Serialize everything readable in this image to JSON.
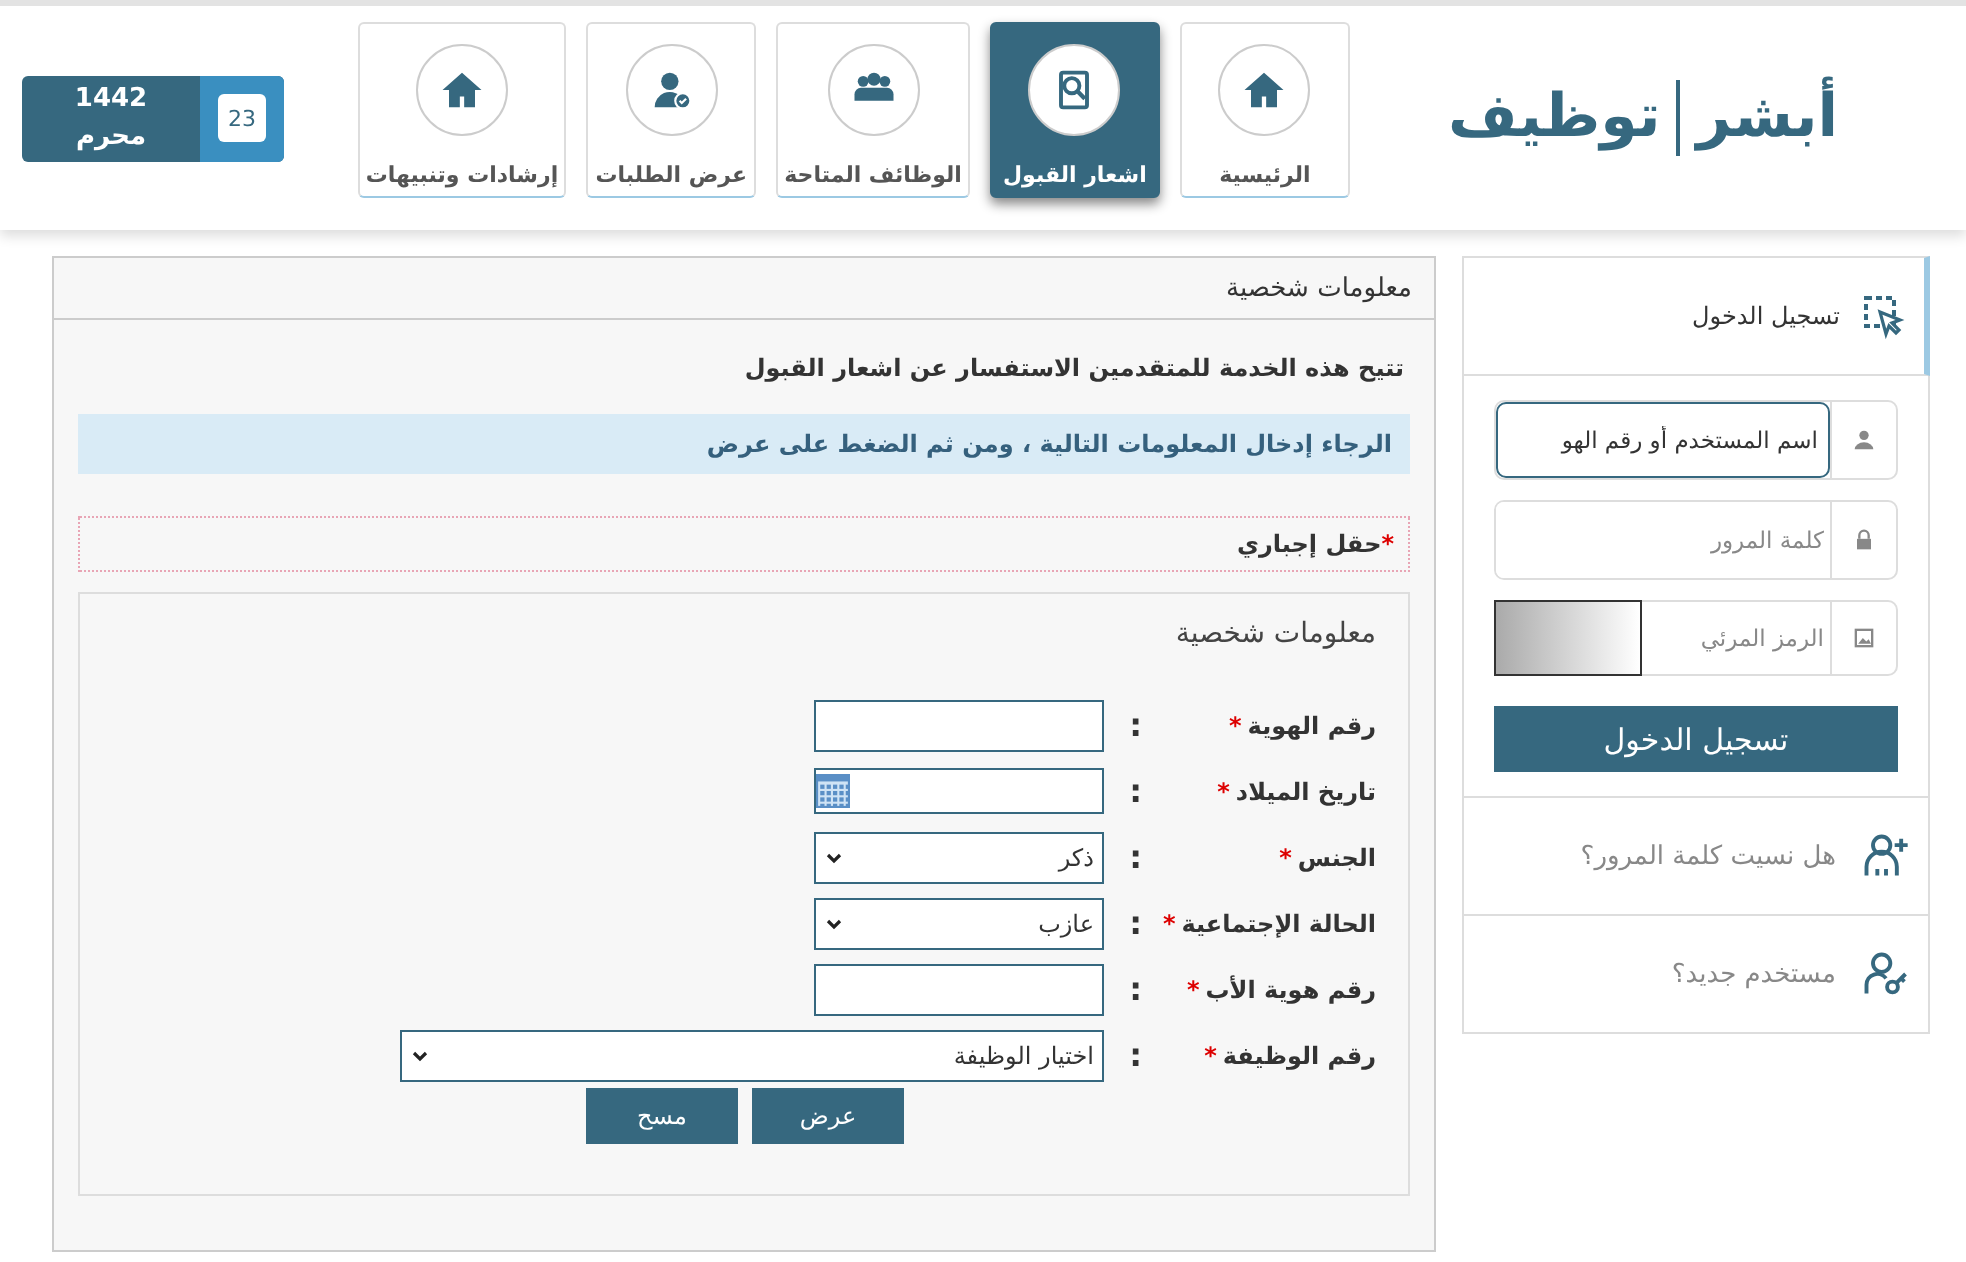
{
  "logo": {
    "primary": "أبشر",
    "secondary": "توظيف"
  },
  "nav": [
    {
      "label": "الرئيسية",
      "selected": false
    },
    {
      "label": "اشعار القبول",
      "selected": true
    },
    {
      "label": "الوظائف المتاحة",
      "selected": false
    },
    {
      "label": "عرض الطلبات",
      "selected": false
    },
    {
      "label": "إرشادات وتنبيهات",
      "selected": false
    }
  ],
  "date": {
    "day": "23",
    "year": "1442",
    "month": "محرم"
  },
  "login": {
    "title": "تسجيل الدخول",
    "fields": [
      {
        "kind": "text",
        "placeholder": "اسم المستخدم أو رقم الهو",
        "focused": true
      },
      {
        "kind": "password",
        "placeholder": "كلمة المرور",
        "focused": false
      },
      {
        "kind": "captcha",
        "placeholder": "الرمز المرئي",
        "focused": false
      }
    ],
    "button": "تسجيل الدخول",
    "links": [
      {
        "label": "هل نسيت كلمة المرور؟"
      },
      {
        "label": "مستخدم جديد؟"
      }
    ]
  },
  "panel": {
    "title": "معلومات شخصية",
    "intro": "تتيح هذه الخدمة للمتقدمين الاستفسار عن اشعار القبول",
    "notice": "الرجاء إدخال المعلومات التالية ، ومن ثم الضغط على عرض",
    "required_mark": "*",
    "required_label": "حقل إجباري",
    "section_title": "معلومات شخصية",
    "form": [
      {
        "kind": "text",
        "label": "رقم الهوية",
        "required": true,
        "separator": ":"
      },
      {
        "kind": "date",
        "label": "تاريخ الميلاد",
        "required": true,
        "separator": ":"
      },
      {
        "kind": "select",
        "label": "الجنس",
        "required": true,
        "separator": ":",
        "value": "ذكر"
      },
      {
        "kind": "select",
        "label": "الحالة الإجتماعية",
        "required": true,
        "separator": ":",
        "value": "عازب"
      },
      {
        "kind": "text",
        "label": "رقم هوية الأب",
        "required": true,
        "separator": ":"
      },
      {
        "kind": "wide-select",
        "label": "رقم الوظيفة",
        "required": true,
        "separator": ":",
        "value": "اختيار الوظيفة"
      }
    ],
    "buttons": [
      "عرض",
      "مسح"
    ]
  }
}
